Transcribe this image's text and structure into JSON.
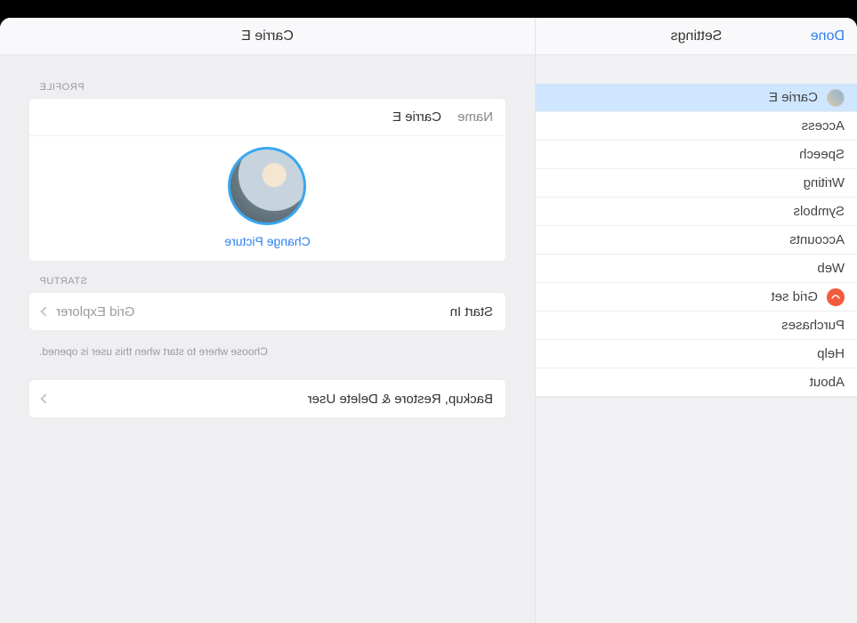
{
  "sidebar": {
    "done_label": "Done",
    "title": "Settings",
    "items": [
      {
        "label": "Carrie E",
        "icon": "avatar",
        "selected": true
      },
      {
        "label": "Access"
      },
      {
        "label": "Speech"
      },
      {
        "label": "Writing"
      },
      {
        "label": "Symbols"
      },
      {
        "label": "Accounts"
      },
      {
        "label": "Web"
      },
      {
        "label": "Grid set",
        "icon": "gridset"
      },
      {
        "label": "Purchases"
      },
      {
        "label": "Help"
      },
      {
        "label": "About"
      }
    ]
  },
  "main": {
    "title": "Carrie E",
    "profile_section_label": "PROFILE",
    "name_row_label": "Name",
    "name_row_value": "Carrie E",
    "change_picture_label": "Change Picture",
    "startup_section_label": "STARTUP",
    "startup_row_label": "Start In",
    "startup_row_value": "Grid Explorer",
    "startup_helper": "Choose where to start when this user is opened.",
    "backup_row_label": "Backup, Restore & Delete User"
  }
}
